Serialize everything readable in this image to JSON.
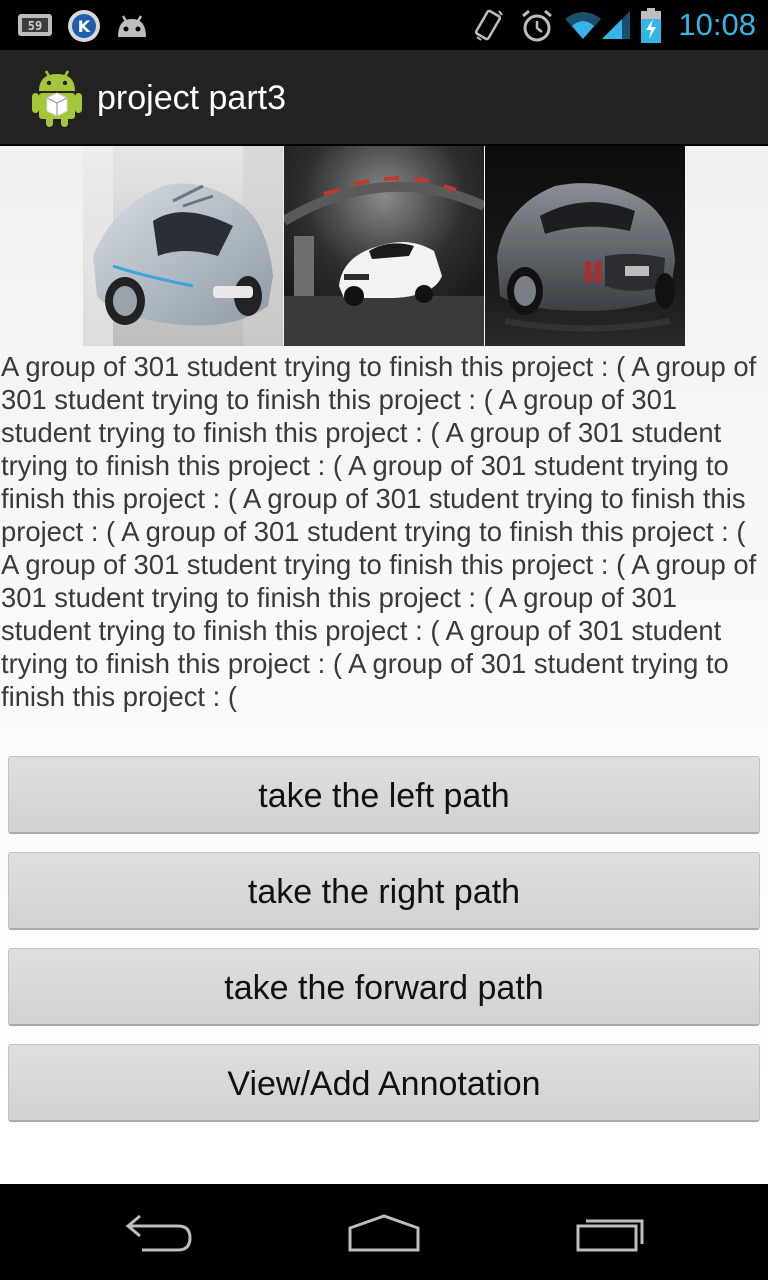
{
  "status_bar": {
    "time": "10:08",
    "left_icons": [
      "sim-signal-icon",
      "k-app-icon",
      "android-robot-icon"
    ],
    "right_icons": [
      "vibrate-icon",
      "alarm-icon",
      "wifi-icon",
      "cell-signal-icon",
      "battery-charging-icon"
    ],
    "accent_color": "#33b5e5"
  },
  "action_bar": {
    "title": "project part3",
    "icon": "android-app-icon"
  },
  "gallery": {
    "images": [
      {
        "name": "silver-roadster-photo"
      },
      {
        "name": "white-sports-car-photo"
      },
      {
        "name": "dark-grey-sports-car-photo"
      }
    ]
  },
  "body": {
    "text": "A group of 301 student trying to finish this project : (  A group of 301 student trying to finish this project : (  A group of 301 student trying to finish this project : (  A group of 301 student trying to finish this project : (  A group of 301 student trying to finish this project : (  A group of 301 student trying to finish this project : (  A group of 301 student trying to finish this project : (  A group of 301 student trying to finish this project : (  A group of 301 student trying to finish this project : (  A group of 301 student trying to finish this project : (  A group of 301 student trying to finish this project : (  A group of 301 student trying to finish this project : ("
  },
  "buttons": {
    "left": "take the left path",
    "right": "take the right path",
    "forward": "take the forward path",
    "annotation": "View/Add Annotation"
  },
  "nav_bar": {
    "icons": [
      "back-icon",
      "home-icon",
      "recent-apps-icon"
    ]
  }
}
